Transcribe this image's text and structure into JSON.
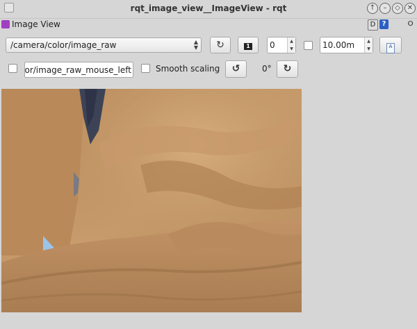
{
  "window": {
    "title": "rqt_image_view__ImageView - rqt"
  },
  "dock": {
    "title": "Image View",
    "d_label": "D",
    "help_label": "?",
    "close_label": "O"
  },
  "toolbar": {
    "topic": "/camera/color/image_raw",
    "frame_index": "0",
    "duration": "10.00m",
    "mouse_topic": "olor/image_raw_mouse_left",
    "smooth_scaling_label": "Smooth scaling",
    "rotation": "0°"
  },
  "icons": {
    "refresh": "refresh-icon",
    "one_to_one": "one-to-one-icon",
    "save": "save-icon",
    "rotate_left": "rotate-left-icon",
    "rotate_right": "rotate-right-icon"
  },
  "checkboxes": {
    "duration_enabled": false,
    "mouse_publish": false,
    "smooth_scaling": false
  }
}
